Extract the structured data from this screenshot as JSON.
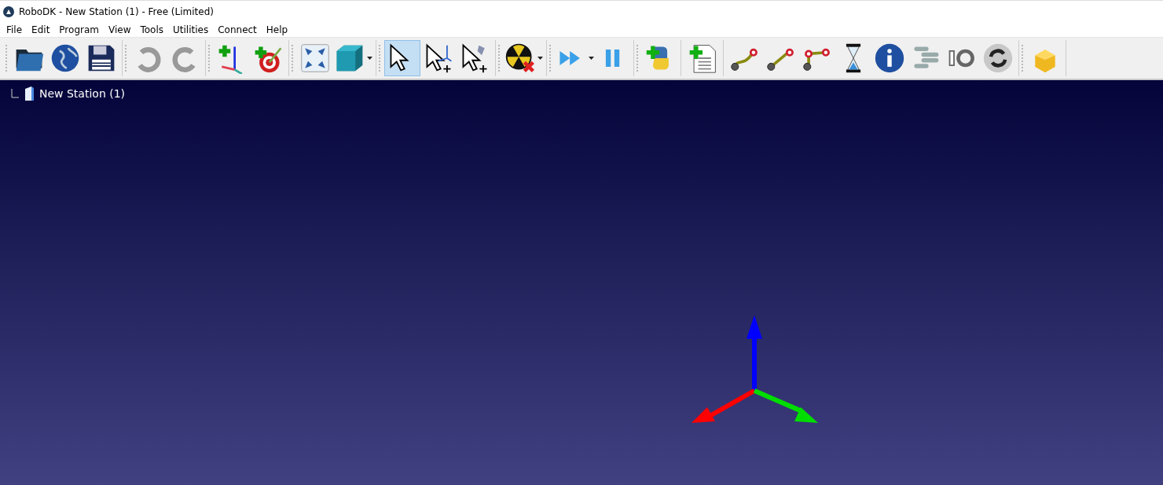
{
  "window": {
    "title": "RoboDK - New Station (1) - Free (Limited)"
  },
  "menu": [
    "File",
    "Edit",
    "Program",
    "View",
    "Tools",
    "Utilities",
    "Connect",
    "Help"
  ],
  "toolbar": [
    {
      "handle": true,
      "tools": [
        {
          "kind": "folder",
          "selected": false,
          "dropdown": false
        },
        {
          "kind": "globe",
          "selected": false,
          "dropdown": false
        },
        {
          "kind": "save",
          "selected": false,
          "dropdown": false
        }
      ]
    },
    {
      "handle": true,
      "tools": [
        {
          "kind": "undo",
          "selected": false,
          "dropdown": false
        },
        {
          "kind": "redo",
          "selected": false,
          "dropdown": false
        }
      ]
    },
    {
      "handle": true,
      "tools": [
        {
          "kind": "frame",
          "selected": false,
          "dropdown": false
        },
        {
          "kind": "target",
          "selected": false,
          "dropdown": false
        }
      ]
    },
    {
      "handle": true,
      "tools": [
        {
          "kind": "fit",
          "selected": false,
          "dropdown": false
        },
        {
          "kind": "cube",
          "selected": false,
          "dropdown": true
        }
      ]
    },
    {
      "handle": true,
      "tools": [
        {
          "kind": "pointer",
          "selected": true,
          "dropdown": false
        },
        {
          "kind": "pointer-frame",
          "selected": false,
          "dropdown": false
        },
        {
          "kind": "pointer-tool",
          "selected": false,
          "dropdown": false
        }
      ]
    },
    {
      "handle": true,
      "tools": [
        {
          "kind": "collision",
          "selected": false,
          "dropdown": true
        }
      ]
    },
    {
      "handle": true,
      "tools": [
        {
          "kind": "run",
          "selected": false,
          "dropdown": true
        },
        {
          "kind": "pause",
          "selected": false,
          "dropdown": false
        }
      ]
    },
    {
      "handle": true,
      "tools": [
        {
          "kind": "python",
          "selected": false,
          "dropdown": false
        }
      ]
    },
    {
      "handle": false,
      "tools": [
        {
          "kind": "program",
          "selected": false,
          "dropdown": false
        }
      ]
    },
    {
      "handle": false,
      "tools": [
        {
          "kind": "joint-move",
          "selected": false,
          "dropdown": false
        },
        {
          "kind": "linear-move",
          "selected": false,
          "dropdown": false
        },
        {
          "kind": "circular-move",
          "selected": false,
          "dropdown": false
        },
        {
          "kind": "hourglass",
          "selected": false,
          "dropdown": false
        },
        {
          "kind": "info",
          "selected": false,
          "dropdown": false
        },
        {
          "kind": "stack",
          "selected": false,
          "dropdown": false
        },
        {
          "kind": "io",
          "selected": false,
          "dropdown": false
        },
        {
          "kind": "refresh",
          "selected": false,
          "dropdown": false
        }
      ]
    },
    {
      "handle": true,
      "tools": [
        {
          "kind": "package",
          "selected": false,
          "dropdown": false
        }
      ]
    }
  ],
  "tree": {
    "items": [
      {
        "label": "New Station (1)"
      }
    ]
  }
}
